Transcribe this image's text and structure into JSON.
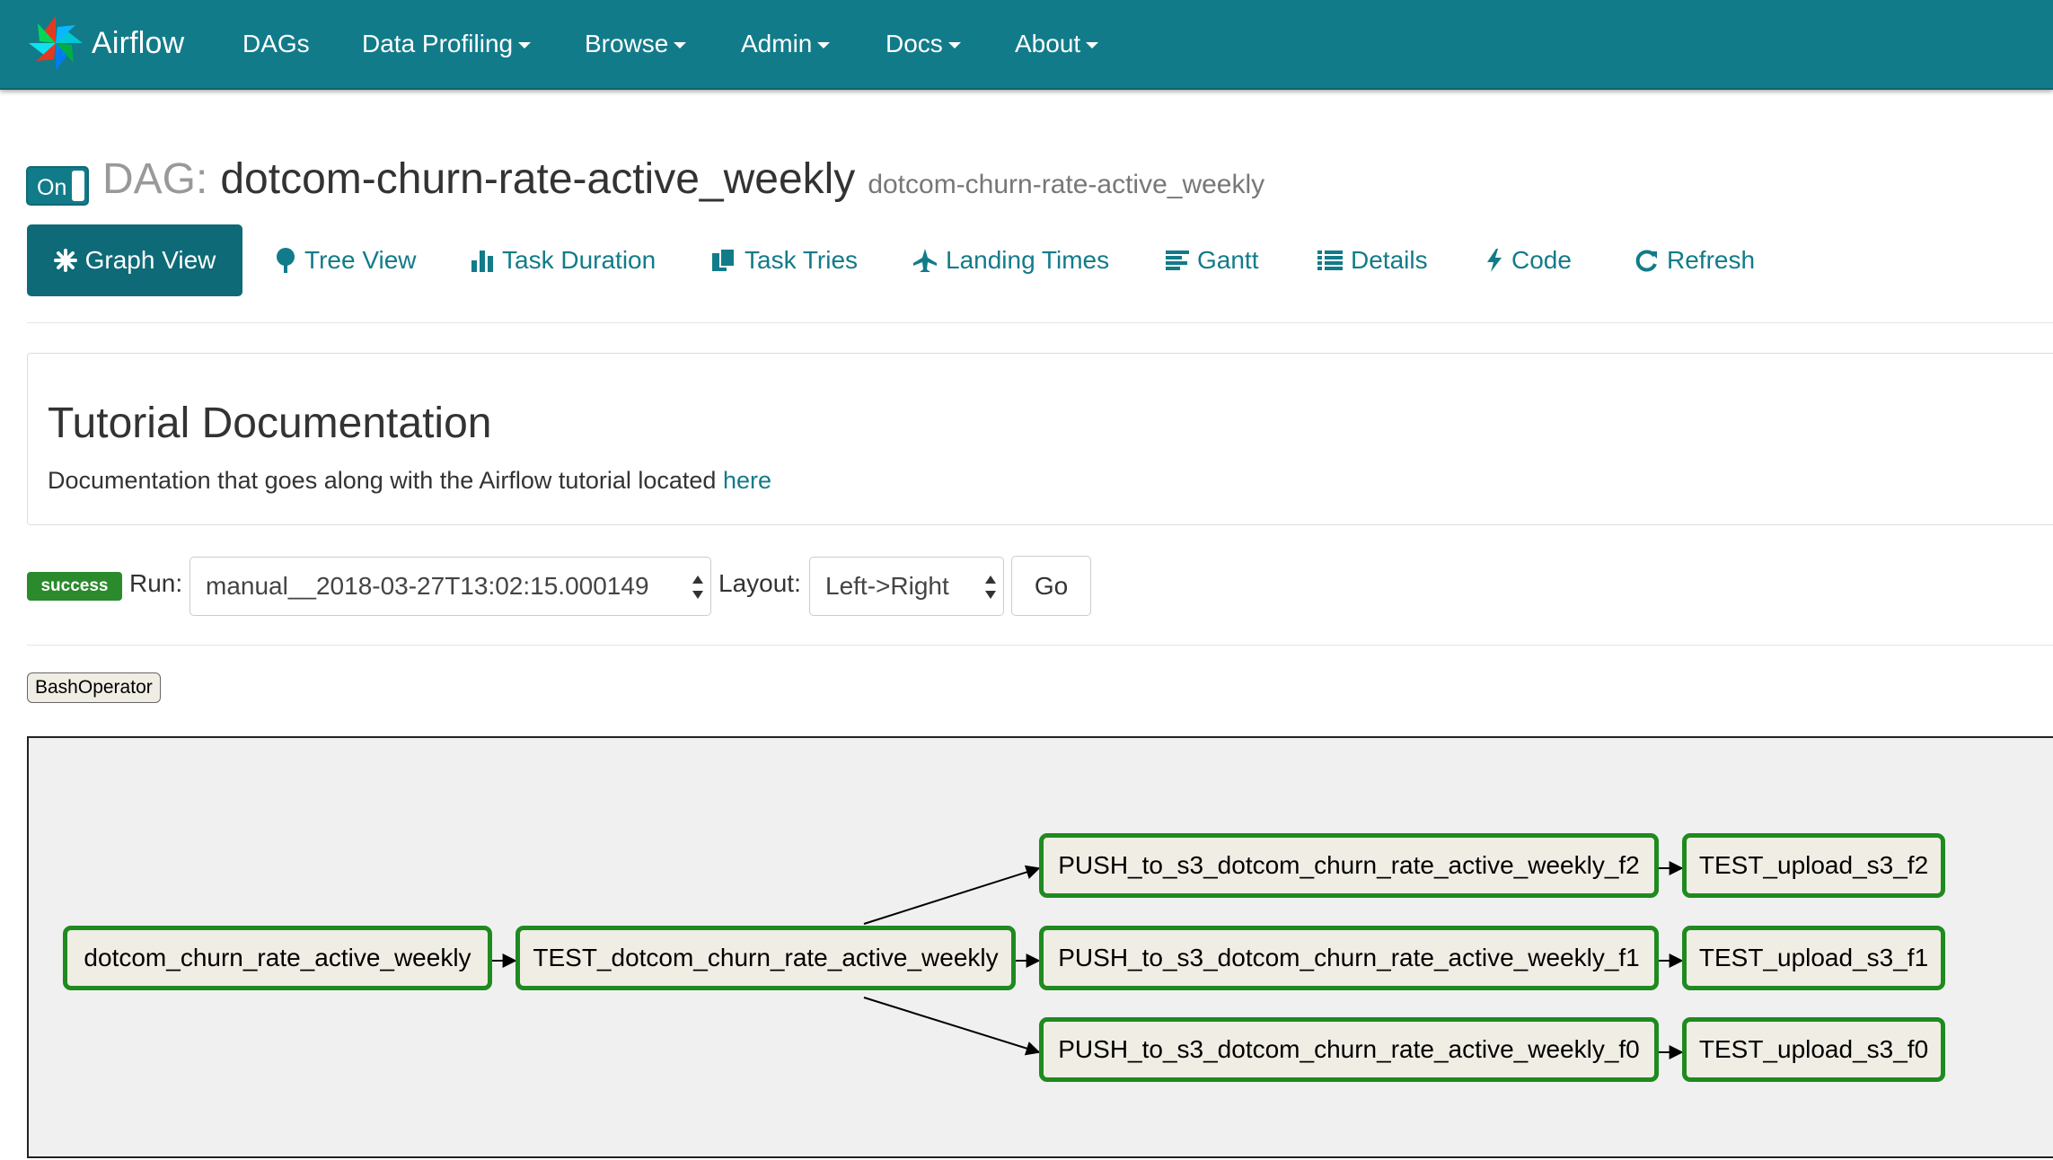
{
  "navbar": {
    "brand": "Airflow",
    "items": [
      {
        "label": "DAGs",
        "dropdown": false
      },
      {
        "label": "Data Profiling",
        "dropdown": true
      },
      {
        "label": "Browse",
        "dropdown": true
      },
      {
        "label": "Admin",
        "dropdown": true
      },
      {
        "label": "Docs",
        "dropdown": true
      },
      {
        "label": "About",
        "dropdown": true
      }
    ],
    "color": "#127b8a"
  },
  "dag": {
    "toggle_label": "On",
    "prefix": "DAG:",
    "name": "dotcom-churn-rate-active_weekly",
    "subtitle": "dotcom-churn-rate-active_weekly"
  },
  "tabs": [
    {
      "label": "Graph View",
      "icon": "asterisk-icon",
      "active": true
    },
    {
      "label": "Tree View",
      "icon": "tree-icon",
      "active": false
    },
    {
      "label": "Task Duration",
      "icon": "bar-chart-icon",
      "active": false
    },
    {
      "label": "Task Tries",
      "icon": "duplicate-icon",
      "active": false
    },
    {
      "label": "Landing Times",
      "icon": "plane-icon",
      "active": false
    },
    {
      "label": "Gantt",
      "icon": "align-left-icon",
      "active": false
    },
    {
      "label": "Details",
      "icon": "list-icon",
      "active": false
    },
    {
      "label": "Code",
      "icon": "flash-icon",
      "active": false
    },
    {
      "label": "Refresh",
      "icon": "refresh-icon",
      "active": false
    }
  ],
  "doc": {
    "title": "Tutorial Documentation",
    "text": "Documentation that goes along with the Airflow tutorial located ",
    "link_text": "here"
  },
  "run_form": {
    "state_badge": "success",
    "run_label": "Run:",
    "run_value": "manual__2018-03-27T13:02:15.000149",
    "layout_label": "Layout:",
    "layout_value": "Left->Right",
    "go_label": "Go"
  },
  "legend": {
    "operators": [
      "BashOperator"
    ]
  },
  "graph": {
    "nodes": [
      {
        "id": "dotcom_churn_rate_active_weekly",
        "label": "dotcom_churn_rate_active_weekly",
        "state": "success"
      },
      {
        "id": "TEST_dotcom_churn_rate_active_weekly",
        "label": "TEST_dotcom_churn_rate_active_weekly",
        "state": "success"
      },
      {
        "id": "PUSH_to_s3_dotcom_churn_rate_active_weekly_f2",
        "label": "PUSH_to_s3_dotcom_churn_rate_active_weekly_f2",
        "state": "success"
      },
      {
        "id": "PUSH_to_s3_dotcom_churn_rate_active_weekly_f1",
        "label": "PUSH_to_s3_dotcom_churn_rate_active_weekly_f1",
        "state": "success"
      },
      {
        "id": "PUSH_to_s3_dotcom_churn_rate_active_weekly_f0",
        "label": "PUSH_to_s3_dotcom_churn_rate_active_weekly_f0",
        "state": "success"
      },
      {
        "id": "TEST_upload_s3_f2",
        "label": "TEST_upload_s3_f2",
        "state": "success"
      },
      {
        "id": "TEST_upload_s3_f1",
        "label": "TEST_upload_s3_f1",
        "state": "success"
      },
      {
        "id": "TEST_upload_s3_f0",
        "label": "TEST_upload_s3_f0",
        "state": "success"
      }
    ],
    "edges": [
      [
        "dotcom_churn_rate_active_weekly",
        "TEST_dotcom_churn_rate_active_weekly"
      ],
      [
        "TEST_dotcom_churn_rate_active_weekly",
        "PUSH_to_s3_dotcom_churn_rate_active_weekly_f2"
      ],
      [
        "TEST_dotcom_churn_rate_active_weekly",
        "PUSH_to_s3_dotcom_churn_rate_active_weekly_f1"
      ],
      [
        "TEST_dotcom_churn_rate_active_weekly",
        "PUSH_to_s3_dotcom_churn_rate_active_weekly_f0"
      ],
      [
        "PUSH_to_s3_dotcom_churn_rate_active_weekly_f2",
        "TEST_upload_s3_f2"
      ],
      [
        "PUSH_to_s3_dotcom_churn_rate_active_weekly_f1",
        "TEST_upload_s3_f1"
      ],
      [
        "PUSH_to_s3_dotcom_churn_rate_active_weekly_f0",
        "TEST_upload_s3_f0"
      ]
    ],
    "success_border_color": "#1f8a1f",
    "operator_fill_color": "#f0ede4"
  }
}
